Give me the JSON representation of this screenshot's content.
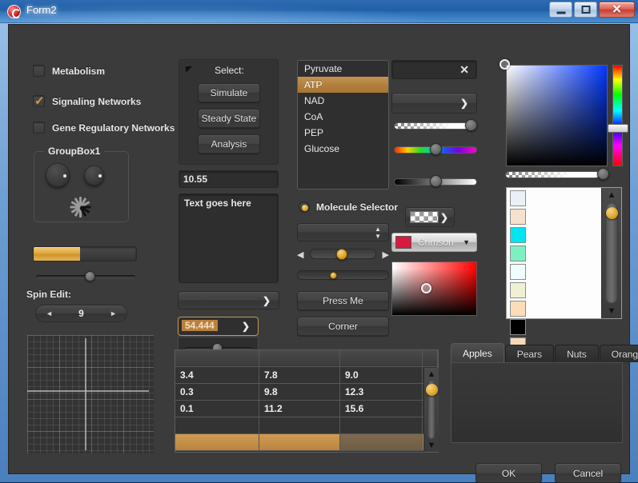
{
  "window": {
    "title": "Form2",
    "icon": "app-icon",
    "buttons": {
      "minimize": "minimize",
      "maximize": "maximize",
      "close": "✕"
    }
  },
  "checkboxes": [
    {
      "label": "Metabolism",
      "checked": false
    },
    {
      "label": "Signaling Networks",
      "checked": true
    },
    {
      "label": "Gene Regulatory Networks",
      "checked": false
    }
  ],
  "groupbox": {
    "title": "GroupBox1"
  },
  "progress": {
    "percent": 45
  },
  "slider_left": {
    "percent": 55
  },
  "spin_edit": {
    "label": "Spin Edit:",
    "value": "9",
    "left_arrow": "◄",
    "right_arrow": "►"
  },
  "select_panel": {
    "title": "Select:",
    "buttons": [
      "Simulate",
      "Steady State",
      "Analysis"
    ]
  },
  "number_field": {
    "value": "10.55"
  },
  "memo": {
    "value": "Text goes here"
  },
  "combo_empty_1": {
    "value": ""
  },
  "spin_combo": {
    "value": "54.444",
    "slider_percent": 45
  },
  "listbox": {
    "items": [
      "Pyruvate",
      "ATP",
      "NAD",
      "CoA",
      "PEP",
      "Glucose"
    ],
    "selected": "ATP"
  },
  "radio": {
    "label": "Molecule Selector",
    "checked": true
  },
  "combo_spinner": {
    "value": ""
  },
  "track_gold": {
    "percent": 50
  },
  "track_small": {
    "percent": 38
  },
  "press_me_button": {
    "label": "Press Me"
  },
  "corner_button": {
    "label": "Corner"
  },
  "clear_field": {
    "value": "",
    "icon": "close-icon"
  },
  "combo_empty_2": {
    "value": ""
  },
  "alpha_slider": {
    "percent": 96
  },
  "hue_slider": {
    "percent": 47
  },
  "gray_slider": {
    "percent": 47
  },
  "checker_combo": {
    "value": ""
  },
  "named_color_combo": {
    "value": "Crimson",
    "swatch": "#d81a3f"
  },
  "red_gradient": {
    "color": "#ff0000"
  },
  "color_picker": {
    "base_hue": "#0037ff",
    "sv_cursor": {
      "x_percent": 1,
      "y_percent": 1
    },
    "hue_handle_percent": 63,
    "alpha_percent": 96
  },
  "swatches": [
    "#eaf0f6",
    "#f6e2cb",
    "#00e5f0",
    "#7ef0c0",
    "#f0fdfd",
    "#f0f0d2",
    "#fbddb8",
    "#000000",
    "#f6d9b8"
  ],
  "table": {
    "headers": [
      "",
      "",
      "",
      ""
    ],
    "rows": [
      [
        "3.4",
        "7.8",
        "9.0",
        ""
      ],
      [
        "0.3",
        "9.8",
        "12.3",
        ""
      ],
      [
        "0.1",
        "11.2",
        "15.6",
        ""
      ],
      [
        "",
        "",
        "",
        ""
      ],
      [
        "",
        "",
        "",
        ""
      ]
    ],
    "selected_row_index": 4
  },
  "tabs": {
    "items": [
      "Apples",
      "Pears",
      "Nuts",
      "Oranges"
    ],
    "active": "Apples"
  },
  "footer": {
    "ok": "OK",
    "cancel": "Cancel"
  },
  "colors": {
    "accent_gold": "#dda424",
    "selection": "#b07f3d",
    "form_bg": "#3b3b3b",
    "title_bg": "#1f5fa8",
    "close_red": "#c63f33"
  }
}
